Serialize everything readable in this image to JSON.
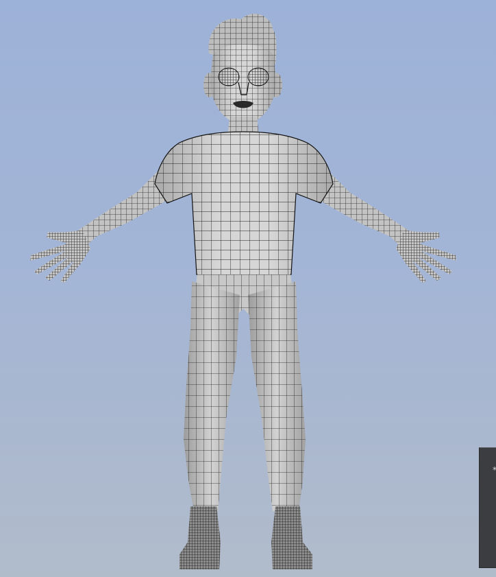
{
  "viewport": {
    "background_top": "#9db2d8",
    "background_bottom": "#b1bccb",
    "model_fill": "#c9c9c9",
    "model_shade": "#9a9a9a",
    "wire_color": "#1a1a1a"
  },
  "side_panel": {
    "glyph": "*",
    "color": "#3b3d41"
  }
}
